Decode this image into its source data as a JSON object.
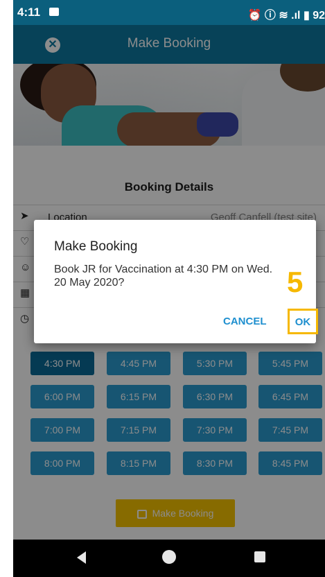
{
  "status_bar": {
    "time": "4:11",
    "right_text": "⏰ ⓘ ≋ .ıl ▮ 92"
  },
  "app_bar": {
    "title": "Make Booking"
  },
  "content": {
    "section_title": "Booking Details",
    "rows": [
      {
        "label": "Location",
        "value": "Geoff Canfell (test site)",
        "icon": "location-arrow-icon"
      },
      {
        "label": "",
        "value": "",
        "icon": "heart-pulse-icon"
      },
      {
        "label": "",
        "value": "",
        "icon": "person-icon"
      },
      {
        "label": "",
        "value": "",
        "icon": "calendar-icon"
      },
      {
        "label": "",
        "value": "",
        "icon": "clock-icon"
      }
    ],
    "time_slots": [
      "4:30 PM",
      "4:45 PM",
      "5:30 PM",
      "5:45 PM",
      "6:00 PM",
      "6:15 PM",
      "6:30 PM",
      "6:45 PM",
      "7:00 PM",
      "7:15 PM",
      "7:30 PM",
      "7:45 PM",
      "8:00 PM",
      "8:15 PM",
      "8:30 PM",
      "8:45 PM"
    ],
    "selected_slot": "4:30 PM",
    "make_booking_label": "Make Booking"
  },
  "dialog": {
    "title": "Make Booking",
    "message": "Book JR for Vaccination at 4:30 PM on Wed. 20 May 2020?",
    "cancel_label": "CANCEL",
    "ok_label": "OK"
  },
  "annotation": {
    "step_number": "5",
    "highlight_color": "#f6b800"
  },
  "colors": {
    "app_bar": "#0d79a1",
    "slot": "#2a9bd0",
    "slot_selected": "#0a6a98",
    "action_button": "#f6c400"
  }
}
